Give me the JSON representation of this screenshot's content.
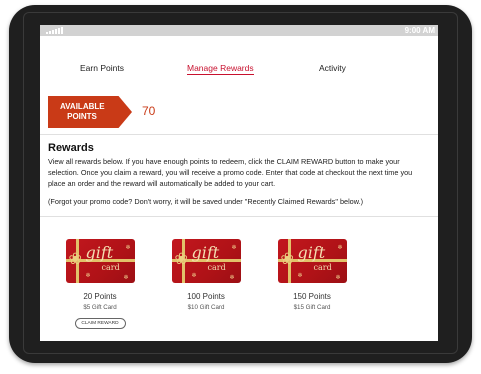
{
  "status_bar": {
    "time": "9:00 AM"
  },
  "tabs": [
    {
      "label": "Earn Points",
      "active": false
    },
    {
      "label": "Manage Rewards",
      "active": true
    },
    {
      "label": "Activity",
      "active": false
    }
  ],
  "points": {
    "badge_label": "AVAILABLE POINTS",
    "value": "70"
  },
  "rewards": {
    "title": "Rewards",
    "description": "View all rewards below. If you have enough points to redeem, click the CLAIM REWARD button to make your selection. Once you claim a reward, you will receive a promo code. Enter that code at checkout the next time you place an order and the reward will automatically be added to your cart.",
    "forgot_note": "(Forgot your promo code? Don't worry, it will be saved under \"Recently Claimed Rewards\" below.)"
  },
  "reward_items": [
    {
      "card_text": "gift",
      "card_sub": "card",
      "points": "20 Points",
      "label": "$5 Gift Card",
      "button": "CLAIM REWARD"
    },
    {
      "card_text": "gift",
      "card_sub": "card",
      "points": "100 Points",
      "label": "$10 Gift Card"
    },
    {
      "card_text": "gift",
      "card_sub": "card",
      "points": "150 Points",
      "label": "$15 Gift Card"
    }
  ],
  "colors": {
    "accent": "#c93a17",
    "tab_active": "#c8102e",
    "card_red": "#b01217",
    "device_frame": "#1f1f1f"
  }
}
